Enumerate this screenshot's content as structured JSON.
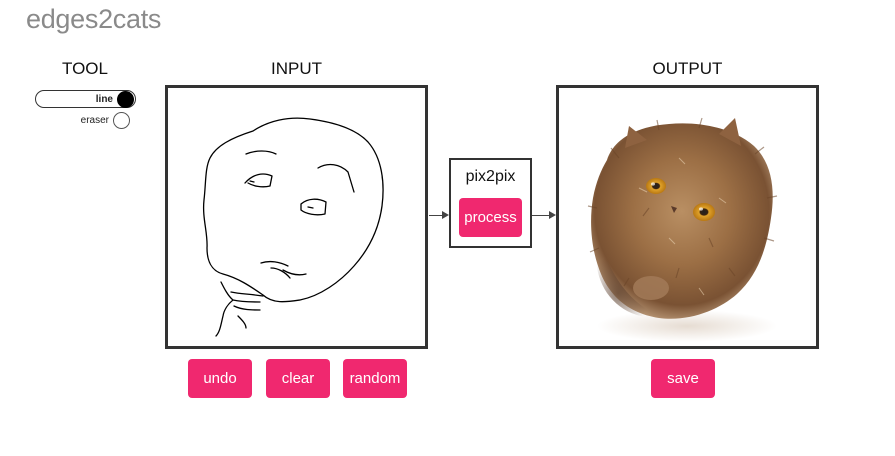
{
  "app": {
    "title": "edges2cats"
  },
  "tool": {
    "label": "TOOL",
    "options": [
      {
        "label": "line",
        "selected": true
      },
      {
        "label": "eraser",
        "selected": false
      }
    ]
  },
  "input": {
    "label": "INPUT",
    "buttons": {
      "undo": "undo",
      "clear": "clear",
      "random": "random"
    }
  },
  "model": {
    "name": "pix2pix",
    "process_label": "process"
  },
  "output": {
    "label": "OUTPUT",
    "save_label": "save",
    "image_description": "generated-cat-image"
  },
  "colors": {
    "accent": "#f0286f",
    "title": "#8a8a8a",
    "border": "#333333"
  }
}
